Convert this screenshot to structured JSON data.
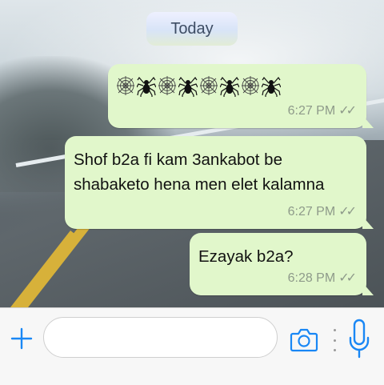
{
  "date_divider": "Today",
  "messages": [
    {
      "type": "emoji",
      "emoji_sequence": [
        "spider-web",
        "spider",
        "spider-web",
        "spider",
        "spider-web",
        "spider",
        "spider-web",
        "spider"
      ],
      "time": "6:27 PM",
      "status": "read"
    },
    {
      "type": "text",
      "text": "Shof b2a fi kam 3ankabot be shabaketo hena men elet kalamna",
      "time": "6:27 PM",
      "status": "read"
    },
    {
      "type": "text",
      "text": "Ezayak b2a?",
      "time": "6:28 PM",
      "status": "read"
    }
  ],
  "input": {
    "value": "",
    "placeholder": ""
  },
  "icons": {
    "attach": "plus-icon",
    "camera": "camera-icon",
    "more": "more-vertical-icon",
    "mic": "microphone-icon"
  },
  "colors": {
    "outgoing_bubble": "#e1f7cb",
    "accent": "#1987f5",
    "date_pill": "#dce7f7"
  }
}
